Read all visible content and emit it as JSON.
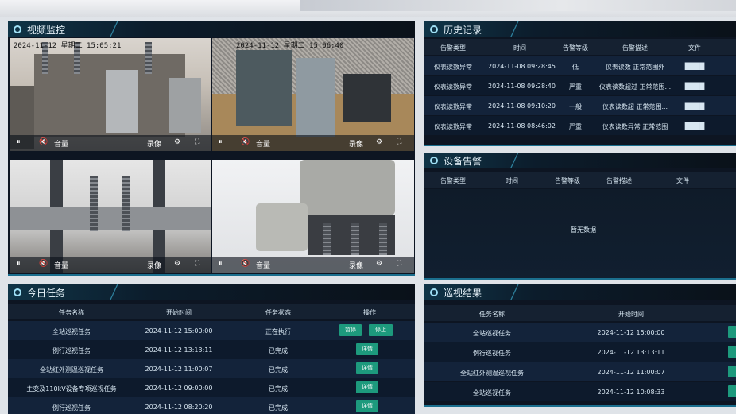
{
  "video": {
    "title": "视频监控",
    "feeds": [
      {
        "osd": "2024-11-12 星期二 15:05:21",
        "ctrl": {
          "pause": "⏸",
          "mute": "🔇",
          "audio": "音量",
          "record": "录像",
          "snap": "⚙",
          "full": "⛶"
        }
      },
      {
        "osd": "2024-11-12 星期二 15:06:40",
        "ctrl": {
          "pause": "⏸",
          "mute": "🔇",
          "audio": "音量",
          "record": "录像",
          "snap": "⚙",
          "full": "⛶"
        }
      },
      {
        "osd": "",
        "ctrl": {
          "pause": "⏸",
          "mute": "🔇",
          "audio": "音量",
          "record": "录像",
          "snap": "⚙",
          "full": "⛶"
        }
      },
      {
        "osd": "",
        "ctrl": {
          "pause": "⏸",
          "mute": "🔇",
          "audio": "音量",
          "record": "录像",
          "snap": "⚙",
          "full": "⛶"
        }
      }
    ]
  },
  "history": {
    "title": "历史记录",
    "headers": [
      "告警类型",
      "时间",
      "告警等级",
      "告警描述",
      "文件"
    ],
    "rows": [
      [
        "仪表读数异常",
        "2024-11-08 09:28:45",
        "低",
        "仪表读数 正常范围外",
        "████"
      ],
      [
        "仪表读数异常",
        "2024-11-08 09:28:40",
        "严重",
        "仪表读数超过 正常范围...",
        "████"
      ],
      [
        "仪表读数异常",
        "2024-11-08 09:10:20",
        "一般",
        "仪表读数超 正常范围...",
        "████"
      ],
      [
        "仪表读数异常",
        "2024-11-08 08:46:02",
        "严重",
        "仪表读数异常 正常范围",
        "████"
      ]
    ]
  },
  "device": {
    "title": "设备告警",
    "headers": [
      "告警类型",
      "时间",
      "告警等级",
      "告警描述",
      "文件"
    ],
    "empty": "暂无数据"
  },
  "tasks": {
    "title": "今日任务",
    "headers": [
      "任务名称",
      "开始时间",
      "任务状态",
      "操作"
    ],
    "rows": [
      {
        "name": "全站巡视任务",
        "time": "2024-11-12 15:00:00",
        "status": "正在执行",
        "actions": [
          "暂停",
          "停止"
        ]
      },
      {
        "name": "例行巡视任务",
        "time": "2024-11-12 13:13:11",
        "status": "已完成",
        "actions": [
          "详情"
        ]
      },
      {
        "name": "全站红外测温巡视任务",
        "time": "2024-11-12 11:00:07",
        "status": "已完成",
        "actions": [
          "详情"
        ]
      },
      {
        "name": "主变及110kV设备专项巡视任务",
        "time": "2024-11-12 09:00:00",
        "status": "已完成",
        "actions": [
          "详情"
        ]
      },
      {
        "name": "例行巡视任务",
        "time": "2024-11-12 08:20:20",
        "status": "已完成",
        "actions": [
          "详情"
        ]
      }
    ]
  },
  "results": {
    "title": "巡视结果",
    "headers": [
      "任务名称",
      "开始时间"
    ],
    "rows": [
      {
        "name": "全站巡视任务",
        "time": "2024-11-12 15:00:00"
      },
      {
        "name": "例行巡视任务",
        "time": "2024-11-12 13:13:11"
      },
      {
        "name": "全站红外测温巡视任务",
        "time": "2024-11-12 11:00:07"
      },
      {
        "name": "全站巡视任务",
        "time": "2024-11-12 10:08:33"
      }
    ]
  }
}
